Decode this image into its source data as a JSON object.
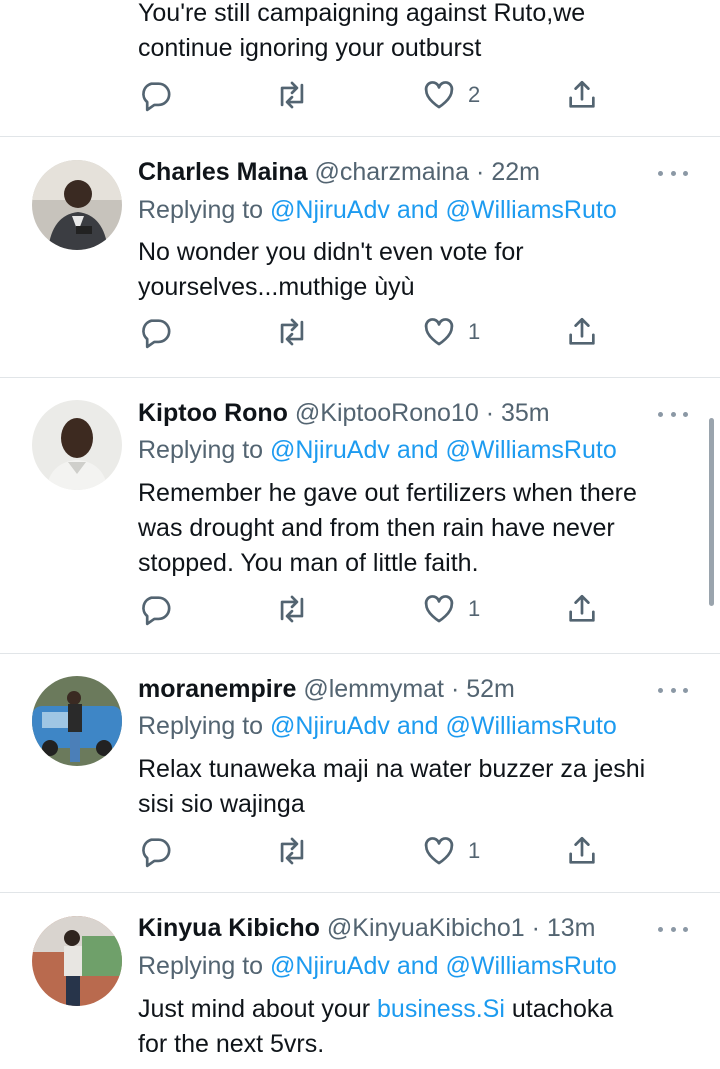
{
  "top_tweet": {
    "text_line1": "You're still campaigning against Ruto,we",
    "text_line2": "continue ignoring your outburst",
    "likes": "2"
  },
  "replies": [
    {
      "name": "Charles Maina",
      "handle": "@charzmaina",
      "time": "22m",
      "replying_prefix": "Replying to",
      "mention1": "@NjiruAdv",
      "and": "and",
      "mention2": "@WilliamsRuto",
      "line1": "No wonder you didn't even vote for",
      "line2": "yourselves...muthige ùyù",
      "likes": "1"
    },
    {
      "name": "Kiptoo Rono",
      "handle": "@KiptooRono10",
      "time": "35m",
      "replying_prefix": "Replying to",
      "mention1": "@NjiruAdv",
      "and": "and",
      "mention2": "@WilliamsRuto",
      "line1": "Remember he gave out fertilizers when there",
      "line2": "was drought and from then rain have never",
      "line3": "stopped. You man of little faith.",
      "likes": "1"
    },
    {
      "name": "moranempire",
      "handle": "@lemmymat",
      "time": "52m",
      "replying_prefix": "Replying to",
      "mention1": "@NjiruAdv",
      "and": "and",
      "mention2": "@WilliamsRuto",
      "line1": "Relax tunaweka maji na water buzzer za jeshi",
      "line2": "sisi sio wajinga",
      "likes": "1"
    },
    {
      "name": "Kinyua Kibicho",
      "handle": "@KinyuaKibicho1",
      "time": "13m",
      "replying_prefix": "Replying to",
      "mention1": "@NjiruAdv",
      "and": "and",
      "mention2": "@WilliamsRuto",
      "line1_prefix": "Just mind about your",
      "line1_link": "business.Si",
      "line1_suffix": "utachoka",
      "line2": "for the next 5vrs."
    }
  ],
  "separator": "·",
  "icons": [
    "reply-icon",
    "retweet-icon",
    "like-icon",
    "share-icon",
    "more-icon"
  ],
  "colors": {
    "accent": "#1d9bf0",
    "muted": "#536471",
    "text": "#0f1419"
  }
}
